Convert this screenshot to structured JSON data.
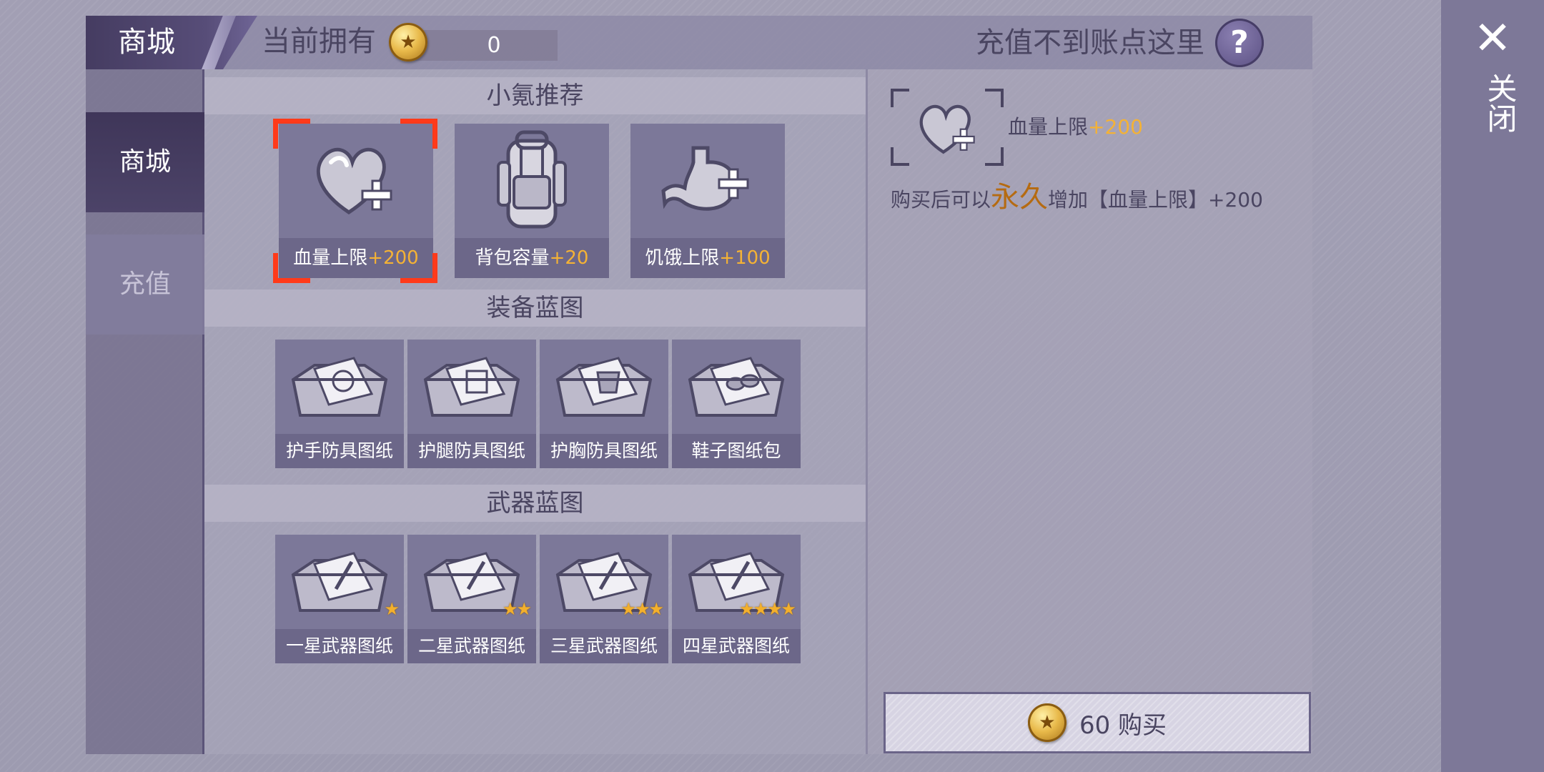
{
  "header": {
    "title": "商城",
    "owned_label": "当前拥有",
    "owned_amount": "0",
    "recharge_hint": "充值不到账点这里",
    "help_label": "?"
  },
  "close": {
    "x": "✕",
    "label": "关闭"
  },
  "sidebar": {
    "items": [
      {
        "label": "商城",
        "selected": true
      },
      {
        "label": "充值",
        "selected": false
      }
    ]
  },
  "sections": {
    "recommend": {
      "title": "小氪推荐",
      "items": [
        {
          "name": "血量上限",
          "bonus": "+200",
          "icon": "heart-plus-icon",
          "selected": true
        },
        {
          "name": "背包容量",
          "bonus": "+20",
          "icon": "backpack-icon",
          "selected": false
        },
        {
          "name": "饥饿上限",
          "bonus": "+100",
          "icon": "stomach-plus-icon",
          "selected": false
        }
      ]
    },
    "equipment": {
      "title": "装备蓝图",
      "items": [
        {
          "name": "护手防具图纸",
          "icon": "gloves-blueprint-icon"
        },
        {
          "name": "护腿防具图纸",
          "icon": "pants-blueprint-icon"
        },
        {
          "name": "护胸防具图纸",
          "icon": "chest-blueprint-icon"
        },
        {
          "name": "鞋子图纸包",
          "icon": "shoes-blueprint-icon"
        }
      ]
    },
    "weapons": {
      "title": "武器蓝图",
      "items": [
        {
          "name": "一星武器图纸",
          "stars": 1,
          "icon": "weapon-blueprint-icon"
        },
        {
          "name": "二星武器图纸",
          "stars": 2,
          "icon": "weapon-blueprint-icon"
        },
        {
          "name": "三星武器图纸",
          "stars": 3,
          "icon": "weapon-blueprint-icon"
        },
        {
          "name": "四星武器图纸",
          "stars": 4,
          "icon": "weapon-blueprint-icon"
        }
      ]
    }
  },
  "detail": {
    "name": "血量上限",
    "bonus": "+200",
    "desc_prefix": "购买后可以",
    "desc_emphasis": "永久",
    "desc_suffix": "增加【血量上限】+200",
    "icon": "heart-plus-icon"
  },
  "buy": {
    "price": "60",
    "label": "购买",
    "text": "60 购买"
  },
  "colors": {
    "accent_gold": "#f4b235",
    "selection": "#ff3a1a",
    "emphasis": "#b56b12"
  }
}
